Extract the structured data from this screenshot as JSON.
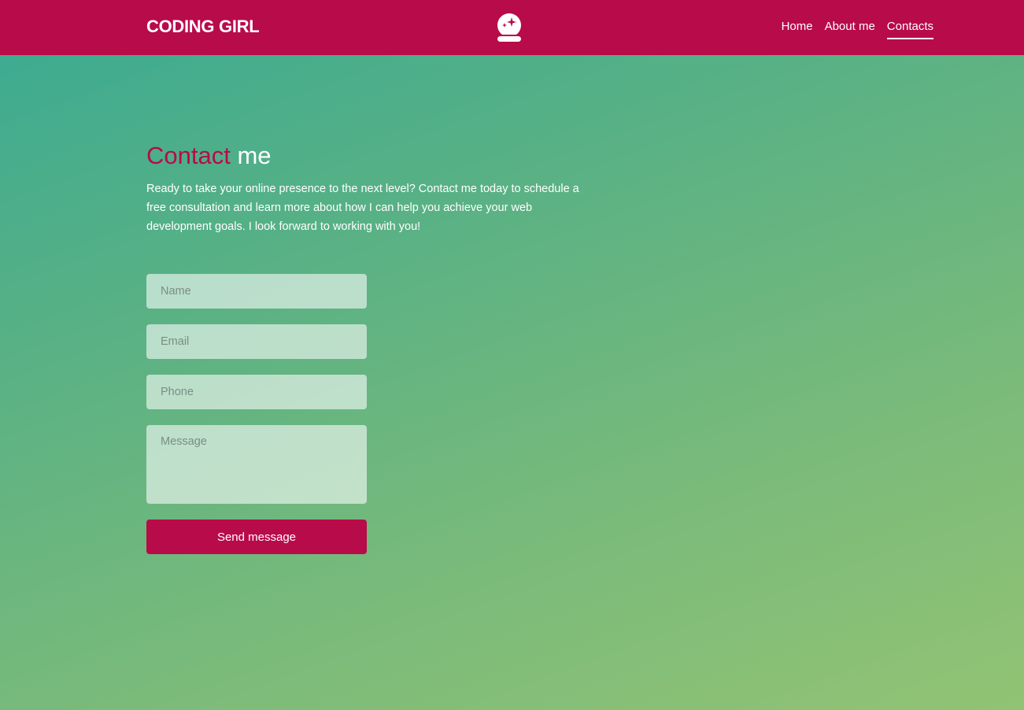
{
  "header": {
    "brand": "CODING GIRL",
    "logo_icon": "crystal-ball-icon",
    "nav": [
      {
        "label": "Home",
        "active": false
      },
      {
        "label": "About me",
        "active": false
      },
      {
        "label": "Contacts",
        "active": true
      }
    ]
  },
  "main": {
    "heading_accent": "Contact",
    "heading_rest": "me",
    "intro": "Ready to take your online presence to the next level? Contact me today to schedule a free consultation and learn more about how I can help you achieve your web development goals. I look forward to working with you!"
  },
  "form": {
    "name_placeholder": "Name",
    "email_placeholder": "Email",
    "phone_placeholder": "Phone",
    "message_placeholder": "Message",
    "submit_label": "Send message"
  },
  "colors": {
    "brand": "#b80b49",
    "background_start": "#3aaa92",
    "background_end": "#92c374",
    "text": "#ffffff"
  }
}
